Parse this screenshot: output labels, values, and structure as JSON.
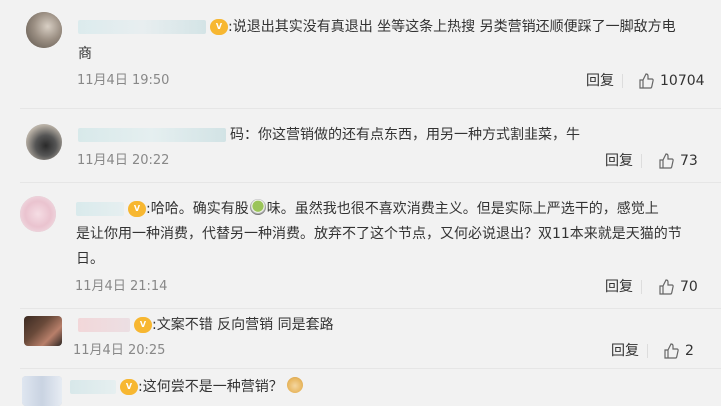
{
  "comments": [
    {
      "username": "",
      "text_line1": "说退出其实没有真退出 坐等这条上热搜 另类营销还顺便踩了一脚敌方电",
      "text_line2": "商",
      "time": "11月4日 19:50",
      "reply_label": "回复",
      "likes": "10704"
    },
    {
      "username": "",
      "text_line1": "你这营销做的还有点东西，用另一种方式割韭菜，牛",
      "time": "11月4日 20:22",
      "reply_label": "回复",
      "likes": "73"
    },
    {
      "username": "",
      "text_a": "哈哈。确实有股",
      "text_b": "味。虽然我也很不喜欢消费主义。但是实际上严选干的，感觉上",
      "text_line2": "是让你用一种消费，代替另一种消费。放弃不了这个节点，又何必说退出？双11本来就是天猫的节",
      "text_line3": "日。",
      "time": "11月4日 21:14",
      "reply_label": "回复",
      "likes": "70"
    },
    {
      "username": "",
      "text_line1": "文案不错 反向营销 同是套路",
      "time": "11月4日 20:25",
      "reply_label": "回复",
      "likes": "2"
    },
    {
      "username": "",
      "text_line1": "这何尝不是一种营销？",
      "time": "",
      "reply_label": "",
      "likes": ""
    }
  ],
  "colors": {
    "background": "#f2f2f2",
    "vip_badge": "#f7b731"
  }
}
